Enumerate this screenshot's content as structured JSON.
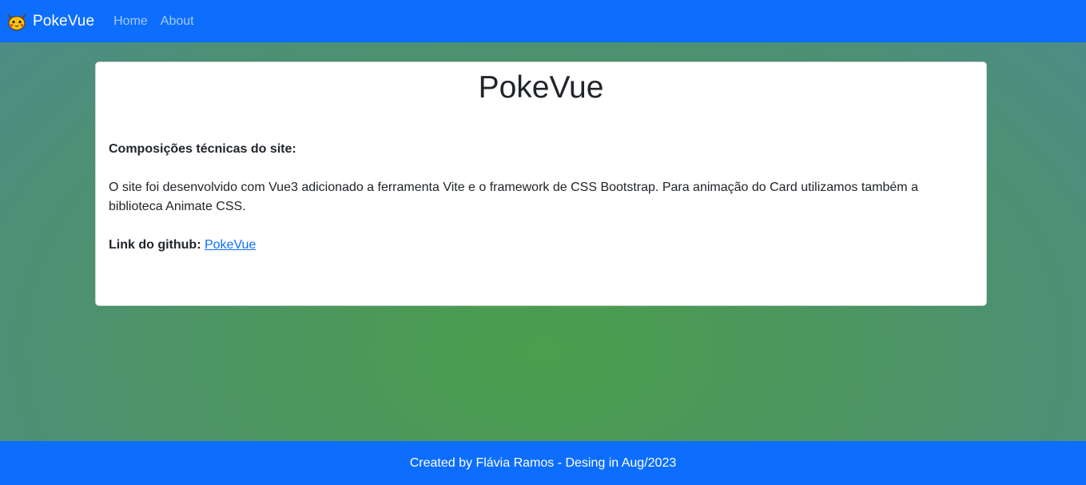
{
  "navbar": {
    "brand": "PokeVue",
    "brand_icon": "pokemon-face-icon",
    "links": [
      "Home",
      "About"
    ]
  },
  "card": {
    "title": "PokeVue",
    "subtitle": "Composições técnicas do site:",
    "description": "O site foi desenvolvido com Vue3 adicionado a ferramenta Vite e o framework de CSS Bootstrap. Para animação do Card utilizamos também a biblioteca Animate CSS.",
    "github_label": "Link do github:",
    "github_link_text": "PokeVue"
  },
  "footer": {
    "text": "Created by Flávia Ramos - Desing in Aug/2023"
  },
  "colors": {
    "primary": "#0d6efd",
    "background_center": "#4a9e4c",
    "background_edge": "#4d8a8e",
    "text": "#212529"
  }
}
